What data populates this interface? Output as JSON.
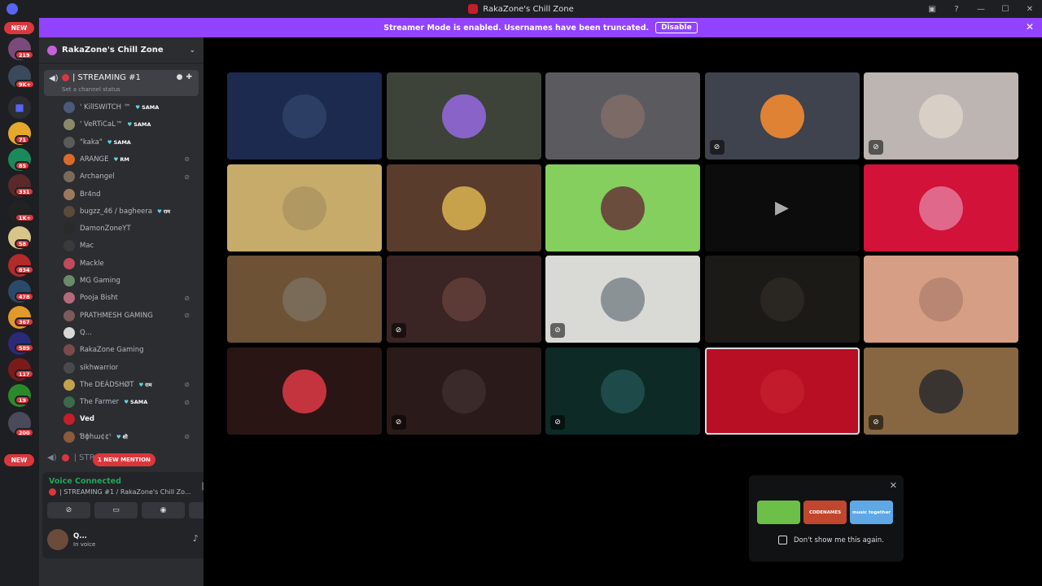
{
  "titlebar": {
    "title": "RakaZone's Chill Zone"
  },
  "banner": {
    "text": "Streamer Mode is enabled. Usernames have been truncated.",
    "disable_label": "Disable"
  },
  "rail": {
    "new_top": "NEW",
    "new_bottom": "NEW",
    "badges": [
      "219",
      "9K+",
      "71",
      "85",
      "331",
      "1K+",
      "58",
      "834",
      "478",
      "367",
      "589",
      "117",
      "19",
      "200"
    ]
  },
  "server": {
    "name": "RakaZone's Chill Zone"
  },
  "channel": {
    "name": "| STREAMING #1",
    "status": "Set a channel status",
    "next_name": "| STR",
    "mention": "1 NEW MENTION"
  },
  "members": [
    {
      "name": "' KillSWITCH ™",
      "tag": "SAMA",
      "muted": false
    },
    {
      "name": "' VeRTiCaL™",
      "tag": "SAMA",
      "muted": false
    },
    {
      "name": "\"kaka\"",
      "tag": "SAMA",
      "muted": false
    },
    {
      "name": "ARANGE",
      "tag": "RM",
      "muted": true
    },
    {
      "name": "Archangel",
      "tag": "",
      "muted": true
    },
    {
      "name": "Br4nd",
      "tag": "",
      "muted": false
    },
    {
      "name": "bugzz_46 / bagheera",
      "tag": "राम",
      "muted": false
    },
    {
      "name": "DamonZoneYT",
      "tag": "",
      "muted": false
    },
    {
      "name": "Mac",
      "tag": "",
      "muted": false
    },
    {
      "name": "Mackle",
      "tag": "",
      "muted": false
    },
    {
      "name": "MG Gaming",
      "tag": "",
      "muted": false
    },
    {
      "name": "Pooja Bisht",
      "tag": "",
      "muted": true
    },
    {
      "name": "PRATHMESH GAMING",
      "tag": "",
      "muted": true
    },
    {
      "name": "Q...",
      "tag": "",
      "muted": false
    },
    {
      "name": "RakaZone Gaming",
      "tag": "",
      "muted": false
    },
    {
      "name": "sikhwarrior",
      "tag": "",
      "muted": false
    },
    {
      "name": "The DEÁDSHØT",
      "tag": "राम",
      "muted": true
    },
    {
      "name": "The Farmer",
      "tag": "SAMA",
      "muted": true
    },
    {
      "name": "Ved",
      "tag": "",
      "muted": false
    },
    {
      "name": "Ɓɸhɯ¢¢ᵗ",
      "tag": "शी",
      "muted": true
    }
  ],
  "voice": {
    "title": "Voice Connected",
    "subtitle": "| STREAMING #1 / RakaZone's Chill Zo..."
  },
  "user": {
    "name": "Q...",
    "status": "In voice"
  },
  "tiles": [
    {
      "bg": "#1c2a4f",
      "av": "#2c3e63",
      "muted": false
    },
    {
      "bg": "#3d4339",
      "av": "#8a63c9",
      "muted": false
    },
    {
      "bg": "#5b5a5f",
      "av": "#7b6a66",
      "muted": false
    },
    {
      "bg": "#3e434d",
      "av": "#e08234",
      "muted": true
    },
    {
      "bg": "#bdb5b1",
      "av": "#d8cfc7",
      "muted": true
    },
    {
      "bg": "#c7ab6b",
      "av": "#b09862",
      "muted": false
    },
    {
      "bg": "#5a3c2c",
      "av": "#c8a24a",
      "muted": false
    },
    {
      "bg": "#84cf5e",
      "av": "#6a4d3d",
      "muted": false
    },
    {
      "bg": "#0c0c0c",
      "av": "#0c0c0c",
      "muted": false
    },
    {
      "bg": "#d21238",
      "av": "#e0688a",
      "muted": false
    },
    {
      "bg": "#6d5236",
      "av": "#7a6a58",
      "muted": false
    },
    {
      "bg": "#3a2424",
      "av": "#5c3a36",
      "muted": true
    },
    {
      "bg": "#d9d9d6",
      "av": "#8b9296",
      "muted": true
    },
    {
      "bg": "#1c1a17",
      "av": "#2a2622",
      "muted": false
    },
    {
      "bg": "#d69e84",
      "av": "#b88672",
      "muted": false
    },
    {
      "bg": "#2a1515",
      "av": "#c4343e",
      "muted": false
    },
    {
      "bg": "#2a1b1a",
      "av": "#3a2a2a",
      "muted": true
    },
    {
      "bg": "#0e2a26",
      "av": "#1f4a4a",
      "muted": true
    },
    {
      "bg": "#b80f24",
      "av": "#c11b2c",
      "muted": false
    },
    {
      "bg": "#866741",
      "av": "#3a3431",
      "muted": true
    }
  ],
  "activity": {
    "cards": [
      {
        "label": "",
        "bg": "#6cc04a"
      },
      {
        "label": "CODENAMES",
        "bg": "#c1462e"
      },
      {
        "label": "music together",
        "bg": "#5fa8e6"
      }
    ],
    "checkbox_label": "Don't show me this again."
  }
}
